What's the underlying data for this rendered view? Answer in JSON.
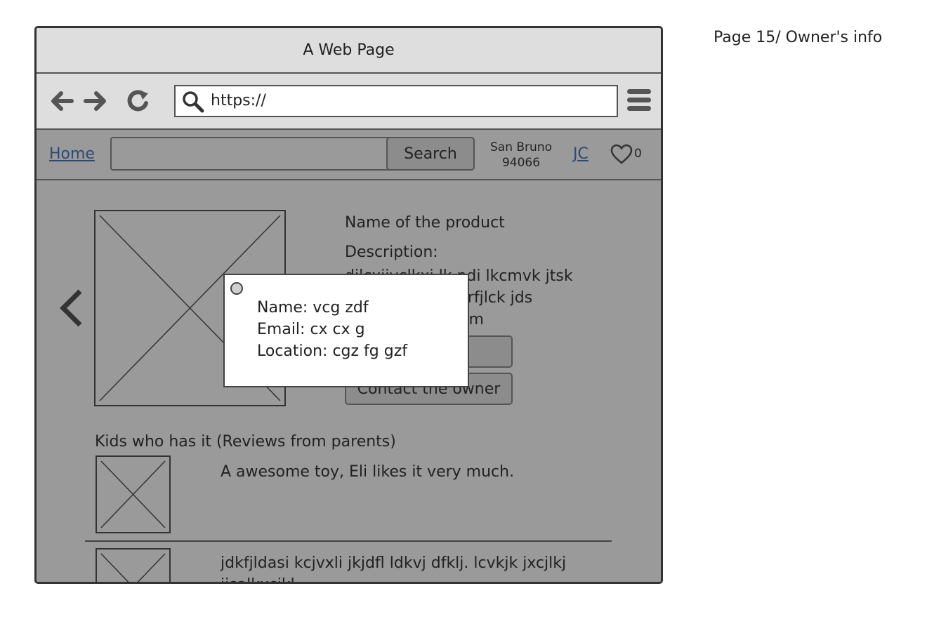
{
  "window": {
    "title": "A Web Page"
  },
  "browser": {
    "url": "https://"
  },
  "header": {
    "home_label": "Home",
    "search_button": "Search",
    "location_city": "San Bruno",
    "location_zip": "94066",
    "user_initials": "JC",
    "favorites_count": "0"
  },
  "product": {
    "name": "Name of the product",
    "description_label": "Description:",
    "description_lines": [
      "dilcxjjvclkxj lk ndi lkcmvk jtsk",
      "lvkjdlvkxmlxk zjrfjlck jds",
      "kjk lcxkm jlei dkm"
    ],
    "button_1": "",
    "contact_button": "Contact the owner"
  },
  "reviews": {
    "title": "Kids who has it (Reviews from parents)",
    "items": [
      {
        "text": "A awesome toy, Eli likes it very much."
      },
      {
        "text": "jdkfjldasi kcjvxli jkjdfl ldkvj dfklj. lcvkjk jxcjlkj jisalkxcjkl"
      }
    ]
  },
  "popup": {
    "name_line": "Name: vcg zdf",
    "email_line": "Email: cx cx g",
    "location_line": "Location: cgz fg gzf"
  },
  "page_label": "Page 15/ Owner's info"
}
